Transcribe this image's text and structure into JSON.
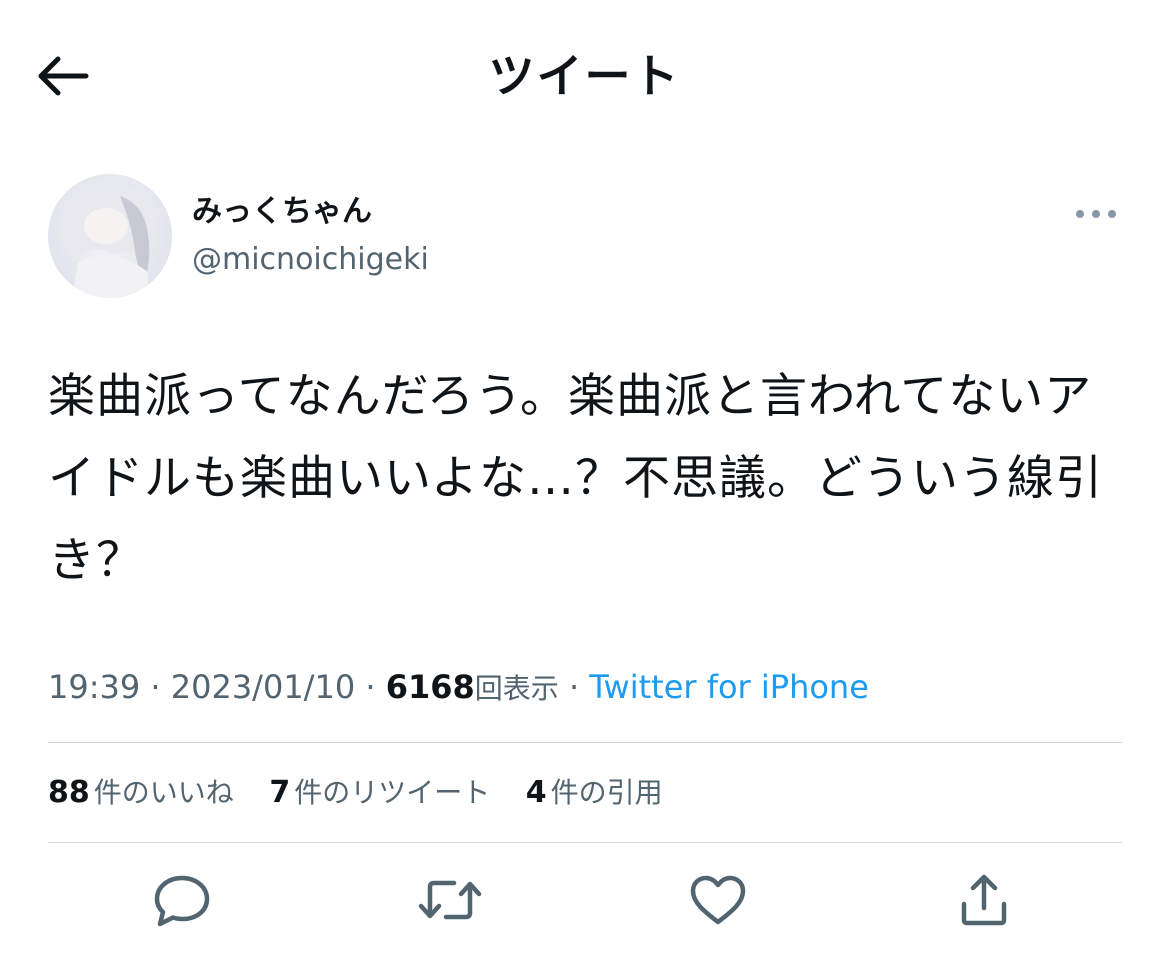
{
  "header": {
    "title": "ツイート",
    "back_icon": "arrow-left-icon"
  },
  "author": {
    "name": "みっくちゃん",
    "handle": "@micnoichigeki",
    "more_icon": "more-horizontal-icon"
  },
  "tweet": {
    "text": "楽曲派ってなんだろう。楽曲派と言われてないアイドルも楽曲いいよな…？不思議。どういう線引き？"
  },
  "meta": {
    "time": "19:39",
    "separator": "·",
    "date": "2023/01/10",
    "views_count": "6168",
    "views_label": "回表示",
    "source": "Twitter for iPhone"
  },
  "stats": {
    "likes": {
      "count": "88",
      "label": "件のいいね"
    },
    "retweets": {
      "count": "7",
      "label": "件のリツイート"
    },
    "quotes": {
      "count": "4",
      "label": "件の引用"
    }
  },
  "actions": [
    {
      "icon": "reply-icon"
    },
    {
      "icon": "retweet-icon"
    },
    {
      "icon": "heart-icon"
    },
    {
      "icon": "share-icon"
    }
  ],
  "colors": {
    "text_primary": "#0f1419",
    "text_secondary": "#536471",
    "link": "#1d9bf0",
    "divider": "#cfd9de",
    "icon_gray": "#536471"
  }
}
